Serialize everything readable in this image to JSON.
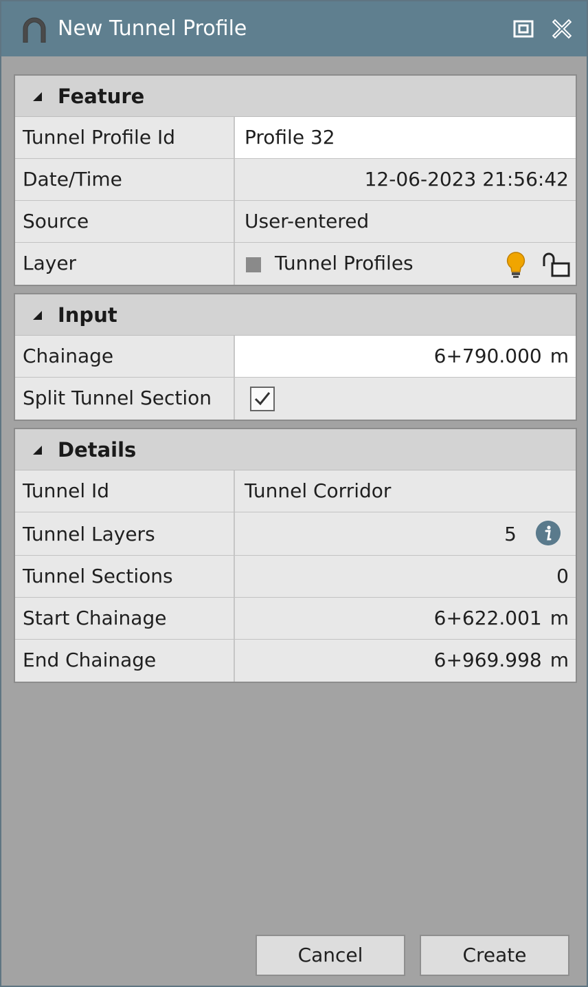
{
  "window": {
    "title": "New Tunnel Profile",
    "icons": [
      "tunnel-icon",
      "restore-icon",
      "close-icon"
    ]
  },
  "sections": {
    "feature": {
      "title": "Feature",
      "profile_id": {
        "label": "Tunnel Profile Id",
        "value": "Profile 32"
      },
      "datetime": {
        "label": "Date/Time",
        "value": "12-06-2023 21:56:42"
      },
      "source": {
        "label": "Source",
        "value": "User-entered"
      },
      "layer": {
        "label": "Layer",
        "value": "Tunnel Profiles",
        "swatch_color": "#8a8a8a",
        "icons": [
          "lightbulb-icon",
          "unlock-icon"
        ]
      }
    },
    "input": {
      "title": "Input",
      "chainage": {
        "label": "Chainage",
        "value": "6+790.000",
        "unit": "m"
      },
      "split": {
        "label": "Split Tunnel Section",
        "checked": true
      }
    },
    "details": {
      "title": "Details",
      "tunnel_id": {
        "label": "Tunnel Id",
        "value": "Tunnel Corridor"
      },
      "tunnel_layers": {
        "label": "Tunnel Layers",
        "value": "5"
      },
      "tunnel_sections": {
        "label": "Tunnel Sections",
        "value": "0"
      },
      "start_chainage": {
        "label": "Start Chainage",
        "value": "6+622.001",
        "unit": "m"
      },
      "end_chainage": {
        "label": "End Chainage",
        "value": "6+969.998",
        "unit": "m"
      }
    }
  },
  "buttons": {
    "cancel": "Cancel",
    "create": "Create"
  },
  "colors": {
    "titlebar": "#5f7f8f",
    "background": "#a3a3a3",
    "bulb": "#f0a500",
    "info": "#5a7a8c"
  }
}
